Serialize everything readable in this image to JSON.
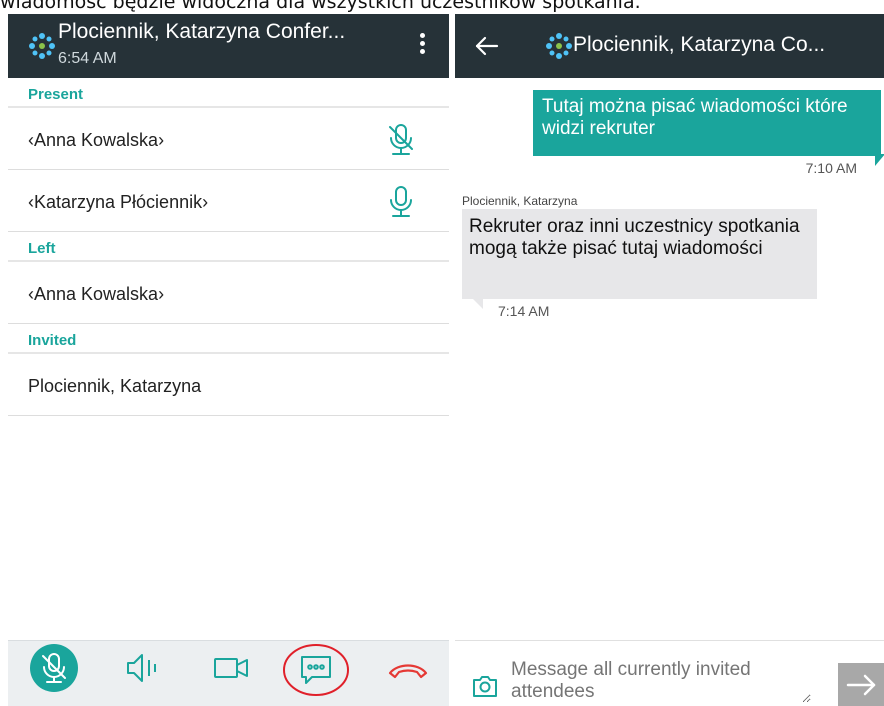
{
  "caption": "wiadomość będzie widoczna dla wszystkich uczestników spotkania.",
  "left_screen": {
    "title": "Plociennik, Katarzyna Confer...",
    "time": "6:54 AM",
    "sections": [
      {
        "header": "Present",
        "rows": [
          {
            "name": "‹Anna Kowalska›",
            "mic": "mic-muted-icon"
          },
          {
            "name": "‹Katarzyna Płócienni­k›",
            "mic": "mic-icon"
          }
        ]
      },
      {
        "header": "Left",
        "rows": [
          {
            "name": "‹Anna Kowalska›"
          }
        ]
      },
      {
        "header": "Invited",
        "rows": [
          {
            "name": "Plociennik, Katarzyna"
          }
        ]
      }
    ],
    "bottom_bar": [
      "mic-muted-icon",
      "speaker-icon",
      "video-camera-icon",
      "chat-icon",
      "hang-up-icon"
    ]
  },
  "right_screen": {
    "title": "Plociennik, Katarzyna Co...",
    "messages": [
      {
        "direction": "outgoing",
        "text": "Tutaj można pisać wiadomości które widzi rekruter",
        "time": "7:10 AM"
      },
      {
        "direction": "incoming",
        "sender": "Plociennik, Katarzyna",
        "text": "Rekruter oraz inni uczestnicy spotkania mogą także pisać tutaj wiadomości",
        "time": "7:14 AM"
      }
    ],
    "compose": {
      "placeholder": "Message all currently invited attendees"
    }
  },
  "colors": {
    "appbar": "#263238",
    "accent": "#1aa59c",
    "hangup": "#e53935",
    "annotation": "#e0202a"
  }
}
